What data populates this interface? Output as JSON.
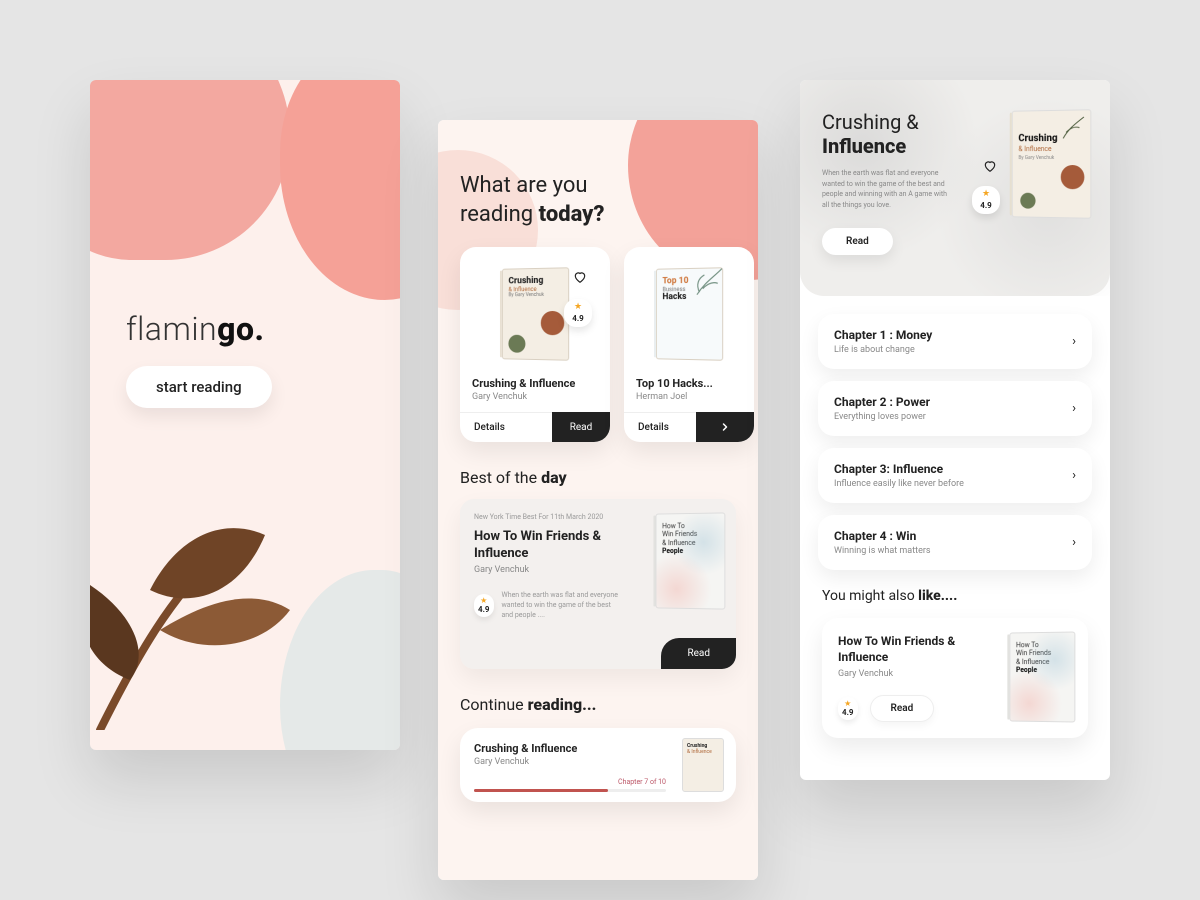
{
  "colors": {
    "pink": "#f3a299",
    "pink_light": "#fdf0ec",
    "text": "#222222",
    "accent_star": "#f5a623",
    "progress": "#c1534f"
  },
  "splash": {
    "brand_light": "flamin",
    "brand_bold": "go.",
    "start_label": "start reading"
  },
  "home": {
    "headline_a": "What are you",
    "headline_b": "reading",
    "headline_c": "today?",
    "featured": [
      {
        "title": "Crushing & Influence",
        "author": "Gary Venchuk",
        "rating": "4.9",
        "details_label": "Details",
        "read_label": "Read",
        "cover_title": "Crushing",
        "cover_sub": "& Influence",
        "cover_by": "By Gary Venchuk"
      },
      {
        "title": "Top 10 Hacks...",
        "author": "Herman Joel",
        "details_label": "Details",
        "cover_title": "Top 10",
        "cover_sub": "Business",
        "cover_by": "Hacks"
      }
    ],
    "best_heading_a": "Best of the",
    "best_heading_b": "day",
    "best": {
      "tag": "New York Time Best For 11th March 2020",
      "title": "How To Win Friends & Influence",
      "author": "Gary Venchuk",
      "rating": "4.9",
      "desc": "When the earth was flat and everyone wanted to win the game of the best and people ....",
      "read_label": "Read",
      "cover_a": "How To",
      "cover_b": "Win Friends",
      "cover_c": "& Influence",
      "cover_d": "People"
    },
    "continue_heading_a": "Continue",
    "continue_heading_b": "reading...",
    "continue": {
      "title": "Crushing & Influence",
      "author": "Gary Venchuk",
      "progress_label": "Chapter 7 of 10",
      "progress_pct": 70
    }
  },
  "detail": {
    "title_a": "Crushing &",
    "title_b": "Influence",
    "desc": "When the earth was flat and everyone wanted to win the game of the best and people and winning with an A game with all the things you love.",
    "rating": "4.9",
    "read_label": "Read",
    "cover_title": "Crushing",
    "cover_sub": "& Influence",
    "cover_by": "By Gary Venchuk",
    "chapters": [
      {
        "title": "Chapter 1 : Money",
        "sub": "Life is about change"
      },
      {
        "title": "Chapter 2 : Power",
        "sub": "Everything loves power"
      },
      {
        "title": "Chapter 3: Influence",
        "sub": "Influence easily like never before"
      },
      {
        "title": "Chapter 4 : Win",
        "sub": "Winning is what matters"
      }
    ],
    "also_heading_a": "You might also",
    "also_heading_b": "like....",
    "also": {
      "title": "How To Win Friends &  Influence",
      "author": "Gary Venchuk",
      "rating": "4.9",
      "read_label": "Read",
      "cover_a": "How To",
      "cover_b": "Win Friends",
      "cover_c": "& Influence",
      "cover_d": "People"
    }
  }
}
